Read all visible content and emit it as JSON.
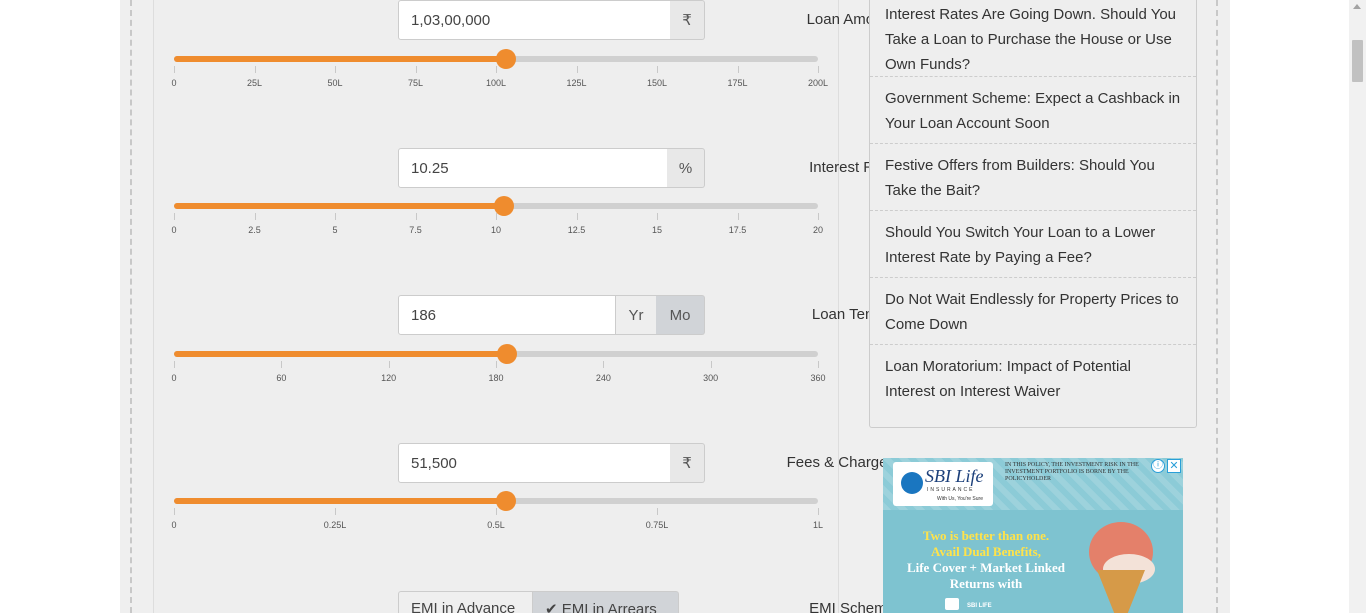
{
  "calculator": {
    "loan_amount": {
      "label": "Loan Amount",
      "value": "1,03,00,000",
      "unit": "₹",
      "slider_fraction": 0.515,
      "ticks": [
        "0",
        "25L",
        "50L",
        "75L",
        "100L",
        "125L",
        "150L",
        "175L",
        "200L"
      ]
    },
    "interest_rate": {
      "label": "Interest Rate",
      "value": "10.25",
      "unit": "%",
      "slider_fraction": 0.5125,
      "ticks": [
        "0",
        "2.5",
        "5",
        "7.5",
        "10",
        "12.5",
        "15",
        "17.5",
        "20"
      ]
    },
    "loan_tenure": {
      "label": "Loan Tenure",
      "value": "186",
      "unit_year": "Yr",
      "unit_month": "Mo",
      "selected_unit": "Mo",
      "slider_fraction": 0.5167,
      "ticks": [
        "0",
        "60",
        "120",
        "180",
        "240",
        "300",
        "360"
      ]
    },
    "fees_charges": {
      "label": "Fees & Charges",
      "value": "51,500",
      "unit": "₹",
      "slider_fraction": 0.515,
      "ticks": [
        "0",
        "0.25L",
        "0.5L",
        "0.75L",
        "1L"
      ]
    },
    "emi_scheme": {
      "label": "EMI Scheme",
      "option_advance": "EMI in Advance",
      "option_arrears": "✔ EMI in Arrears",
      "selected": "EMI in Arrears"
    },
    "colors": {
      "slider_fill": "#ef8c2e",
      "slider_track": "#d0d0d0"
    }
  },
  "sidebar": {
    "items": [
      {
        "label": "Interest Rates Are Going Down. Should You Take a Loan to Purchase the House or Use Own Funds?"
      },
      {
        "label": "Government Scheme: Expect a Cashback in Your Loan Account Soon"
      },
      {
        "label": "Festive Offers from Builders: Should You Take the Bait?"
      },
      {
        "label": "Should You Switch Your Loan to a Lower Interest Rate by Paying a Fee?"
      },
      {
        "label": "Do Not Wait Endlessly for Property Prices to Come Down"
      },
      {
        "label": "Loan Moratorium: Impact of Potential Interest on Interest Waiver"
      }
    ]
  },
  "ad": {
    "brand": "SBI Life",
    "brand_sub": "INSURANCE",
    "tagline": "With Us, You're Sure",
    "disclaimer": "IN THIS POLICY, THE INVESTMENT RISK IN THE INVESTMENT PORTFOLIO IS BORNE BY THE POLICYHOLDER",
    "info_icon": "ⓘ",
    "close_icon": "✕",
    "headline_line1": "Two is better than one.",
    "headline_line2": "Avail Dual Benefits,",
    "headline_line3": "Life Cover + Market Linked",
    "headline_line4": "Returns with",
    "footer_brand": "SBI LIFE"
  }
}
